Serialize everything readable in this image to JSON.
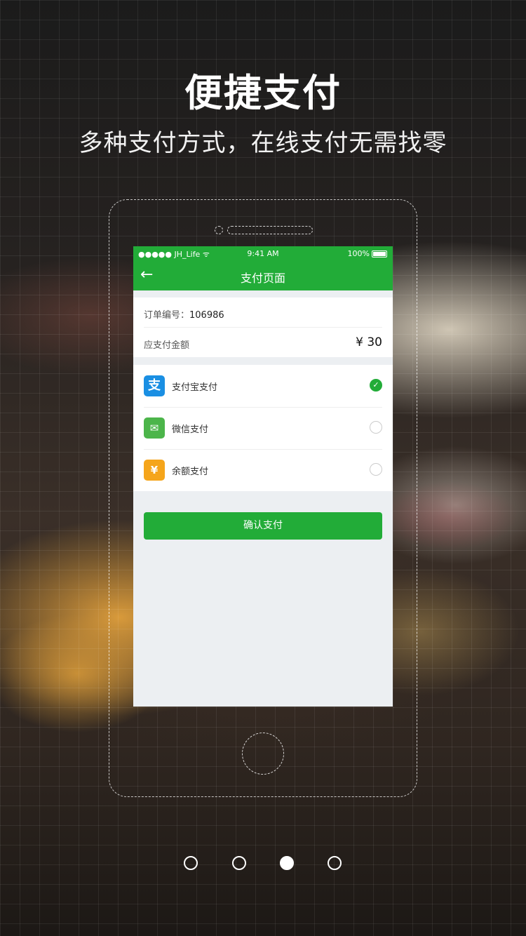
{
  "headline": "便捷支付",
  "subheadline": "多种支付方式，在线支付无需找零",
  "colors": {
    "primary_green": "#22ac38",
    "alipay_blue": "#1a8fe3",
    "wechat_green": "#4cb54a",
    "balance_orange": "#f5a51b"
  },
  "status_bar": {
    "carrier": "●●●●● JH_Life ᯤ",
    "time": "9:41 AM",
    "battery": "100%"
  },
  "nav": {
    "back_icon": "arrow-left-icon",
    "title": "支付页面"
  },
  "order": {
    "number_label": "订单编号：",
    "number_value": "106986",
    "amount_label": "应支付金额",
    "amount_value": "¥ 30"
  },
  "payment_methods": [
    {
      "name": "支付宝支付",
      "icon": "alipay-icon",
      "glyph": "支",
      "selected": true
    },
    {
      "name": "微信支付",
      "icon": "wechat-icon",
      "glyph": "✉",
      "selected": false
    },
    {
      "name": "余额支付",
      "icon": "balance-bag-icon",
      "glyph": "¥",
      "selected": false
    }
  ],
  "confirm_label": "确认支付",
  "pagination": {
    "total": 4,
    "current": 3
  }
}
